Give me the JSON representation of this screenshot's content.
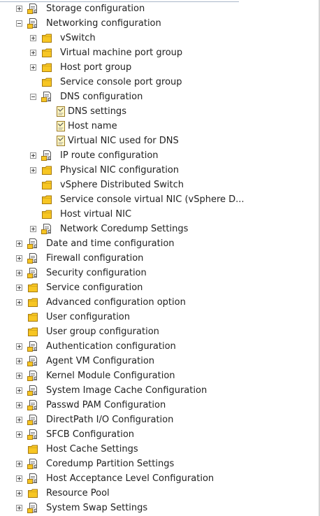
{
  "colors": {
    "folder_fill": "#f7c623",
    "folder_stroke": "#a5780e",
    "doc_fill": "#ffffff",
    "doc_stroke": "#555555",
    "gear": "#7d7d7d",
    "note_fill": "#fff7c2",
    "note_stroke": "#9a7a2a"
  },
  "tree": [
    {
      "level": 0,
      "toggle": "plus",
      "icon": "config-folder-icon",
      "label": "Storage configuration"
    },
    {
      "level": 0,
      "toggle": "minus",
      "icon": "config-folder-icon",
      "label": "Networking configuration"
    },
    {
      "level": 1,
      "toggle": "plus",
      "icon": "folder-icon",
      "label": "vSwitch"
    },
    {
      "level": 1,
      "toggle": "plus",
      "icon": "folder-icon",
      "label": "Virtual machine port group"
    },
    {
      "level": 1,
      "toggle": "plus",
      "icon": "folder-icon",
      "label": "Host port group"
    },
    {
      "level": 1,
      "toggle": "none",
      "icon": "folder-icon",
      "label": "Service console port group"
    },
    {
      "level": 1,
      "toggle": "minus",
      "icon": "config-folder-icon",
      "label": "DNS configuration"
    },
    {
      "level": 2,
      "toggle": "none",
      "icon": "setting-doc-icon",
      "label": "DNS settings"
    },
    {
      "level": 2,
      "toggle": "none",
      "icon": "setting-doc-icon",
      "label": "Host name"
    },
    {
      "level": 2,
      "toggle": "none",
      "icon": "setting-doc-icon",
      "label": "Virtual NIC used for DNS"
    },
    {
      "level": 1,
      "toggle": "plus",
      "icon": "config-folder-icon",
      "label": "IP route configuration"
    },
    {
      "level": 1,
      "toggle": "plus",
      "icon": "folder-icon",
      "label": "Physical NIC configuration"
    },
    {
      "level": 1,
      "toggle": "none",
      "icon": "folder-icon",
      "label": "vSphere Distributed Switch"
    },
    {
      "level": 1,
      "toggle": "none",
      "icon": "folder-icon",
      "label": "Service console virtual NIC (vSphere D..."
    },
    {
      "level": 1,
      "toggle": "none",
      "icon": "folder-icon",
      "label": "Host virtual NIC"
    },
    {
      "level": 1,
      "toggle": "plus",
      "icon": "config-folder-icon",
      "label": "Network Coredump Settings"
    },
    {
      "level": 0,
      "toggle": "plus",
      "icon": "config-folder-icon",
      "label": "Date and time configuration"
    },
    {
      "level": 0,
      "toggle": "plus",
      "icon": "config-folder-icon",
      "label": "Firewall configuration"
    },
    {
      "level": 0,
      "toggle": "plus",
      "icon": "config-folder-icon",
      "label": "Security configuration"
    },
    {
      "level": 0,
      "toggle": "plus",
      "icon": "folder-icon",
      "label": "Service configuration"
    },
    {
      "level": 0,
      "toggle": "plus",
      "icon": "folder-icon",
      "label": "Advanced configuration option"
    },
    {
      "level": 0,
      "toggle": "none",
      "icon": "folder-icon",
      "label": "User configuration"
    },
    {
      "level": 0,
      "toggle": "none",
      "icon": "folder-icon",
      "label": "User group configuration"
    },
    {
      "level": 0,
      "toggle": "plus",
      "icon": "config-folder-icon",
      "label": "Authentication configuration"
    },
    {
      "level": 0,
      "toggle": "plus",
      "icon": "config-folder-icon",
      "label": "Agent VM Configuration"
    },
    {
      "level": 0,
      "toggle": "plus",
      "icon": "config-folder-icon",
      "label": "Kernel Module Configuration"
    },
    {
      "level": 0,
      "toggle": "plus",
      "icon": "config-folder-icon",
      "label": "System Image Cache Configuration"
    },
    {
      "level": 0,
      "toggle": "plus",
      "icon": "config-folder-icon",
      "label": "Passwd PAM Configuration"
    },
    {
      "level": 0,
      "toggle": "plus",
      "icon": "config-folder-icon",
      "label": "DirectPath I/O Configuration"
    },
    {
      "level": 0,
      "toggle": "plus",
      "icon": "config-folder-icon",
      "label": "SFCB Configuration"
    },
    {
      "level": 0,
      "toggle": "none",
      "icon": "folder-icon",
      "label": "Host Cache Settings"
    },
    {
      "level": 0,
      "toggle": "plus",
      "icon": "config-folder-icon",
      "label": "Coredump Partition Settings"
    },
    {
      "level": 0,
      "toggle": "plus",
      "icon": "config-folder-icon",
      "label": "Host Acceptance Level Configuration"
    },
    {
      "level": 0,
      "toggle": "plus",
      "icon": "folder-icon",
      "label": "Resource Pool"
    },
    {
      "level": 0,
      "toggle": "plus",
      "icon": "config-folder-icon",
      "label": "System Swap Settings"
    }
  ]
}
